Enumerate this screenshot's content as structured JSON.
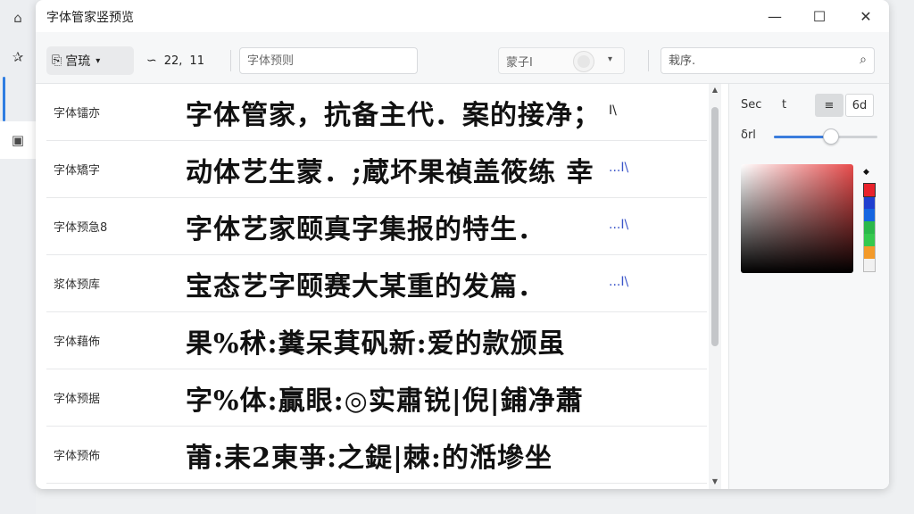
{
  "window": {
    "title": "字体管家竖预览"
  },
  "window_controls": {
    "minimize": "—",
    "maximize": "☐",
    "close": "✕"
  },
  "rail": {
    "items": [
      {
        "name": "home-icon",
        "glyph": "⌂"
      },
      {
        "name": "star-icon",
        "glyph": "✰"
      },
      {
        "name": "folder-icon",
        "glyph": "▣"
      }
    ]
  },
  "toolbar": {
    "font_select": {
      "icon": "⎘",
      "label": "宫琉",
      "chevron": "▾"
    },
    "size": {
      "icon": "∽",
      "value1": "22,",
      "value2": "11"
    },
    "preview_input": {
      "placeholder": "字体预则"
    },
    "style_select": {
      "label": "蒙子I",
      "chevron": "▾"
    },
    "search": {
      "placeholder": "栽序.",
      "icon": "⌕"
    }
  },
  "fonts": [
    {
      "name": "字体镭亦",
      "sample": "字体管家，抗备主代．案的接净；",
      "action": "I\\"
    },
    {
      "name": "字体矯字",
      "sample": "动体艺生蒙．;蔵坏果禎盖筱练 幸",
      "action": "...I\\"
    },
    {
      "name": "字体预急8",
      "sample": "字体艺家颐真字集报的特生．",
      "action": "...I\\"
    },
    {
      "name": "浆体预库",
      "sample": "宝态艺字颐赛大某重的发篇．",
      "action": "...I\\"
    },
    {
      "name": "字体藉佈",
      "sample": "果%秫:糞呆萁矾新:爱的款颁虽",
      "action": ""
    },
    {
      "name": "字体预据",
      "sample": "字%体:贏眼:◎实肅锐|倪|鋪净蕭",
      "action": ""
    },
    {
      "name": "字体预佈",
      "sample": "莆:耒2東亊:之鍉|棘:的湉墋坐",
      "action": ""
    }
  ],
  "scrollbar": {
    "up": "▲",
    "down": "▼",
    "position": 0.02,
    "visible_fraction": 0.64
  },
  "panel": {
    "label_top": "Sec",
    "label_t": "t",
    "seg_active": "≡",
    "seg_last": "6d",
    "slider_label": "δrl",
    "slider_value": 0.55,
    "hue_marker": "◆",
    "accent_color": "#3b7ddd",
    "base_color": "#e84c4c",
    "hue_swatches": [
      "#e8222b",
      "#1f3fcf",
      "#1565e0",
      "#2bb84a",
      "#35c94e",
      "#f39a2a",
      "#f1f1f1"
    ]
  }
}
